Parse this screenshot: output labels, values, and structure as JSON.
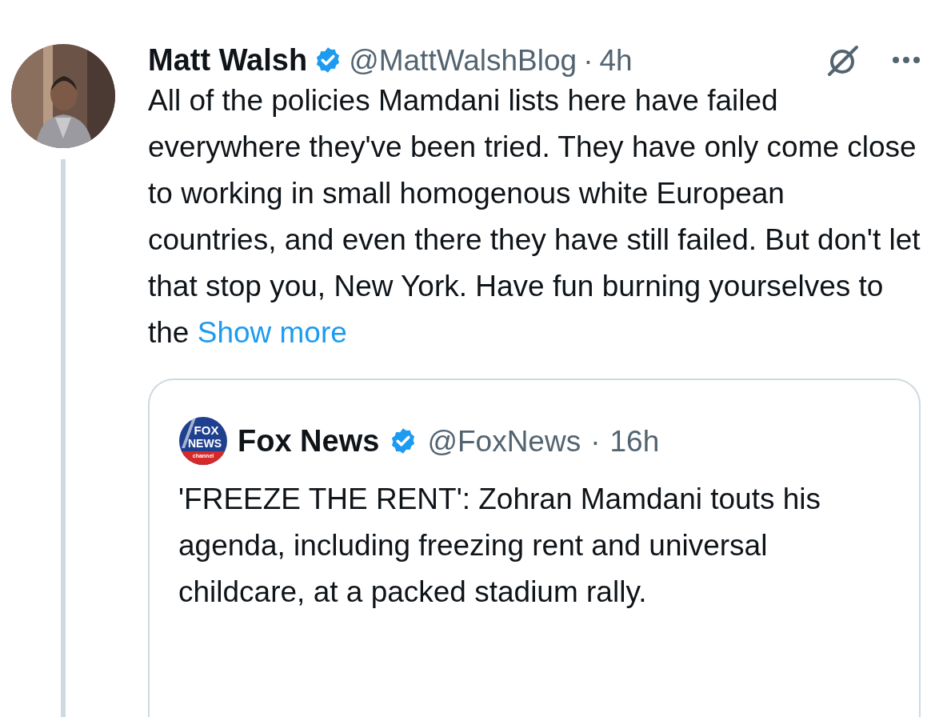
{
  "post": {
    "author": {
      "name": "Matt Walsh",
      "verified": true,
      "handle": "@MattWalshBlog",
      "separator": "·",
      "time": "4h"
    },
    "text": "All of the policies Mamdani lists here have failed everywhere they've been tried. They have only come close to working in small homogenous white European countries, and even there they have still failed. But don't let that stop you, New York. Have fun burning yourselves to the",
    "show_more": "Show more",
    "quote": {
      "logo_text": [
        "FOX",
        "NEWS",
        "channel"
      ],
      "author": {
        "name": "Fox News",
        "verified": true,
        "handle": "@FoxNews",
        "separator": "·",
        "time": "16h"
      },
      "text": "'FREEZE THE RENT': Zohran Mamdani touts his agenda, including freezing rent and universal childcare, at a packed stadium rally."
    }
  }
}
